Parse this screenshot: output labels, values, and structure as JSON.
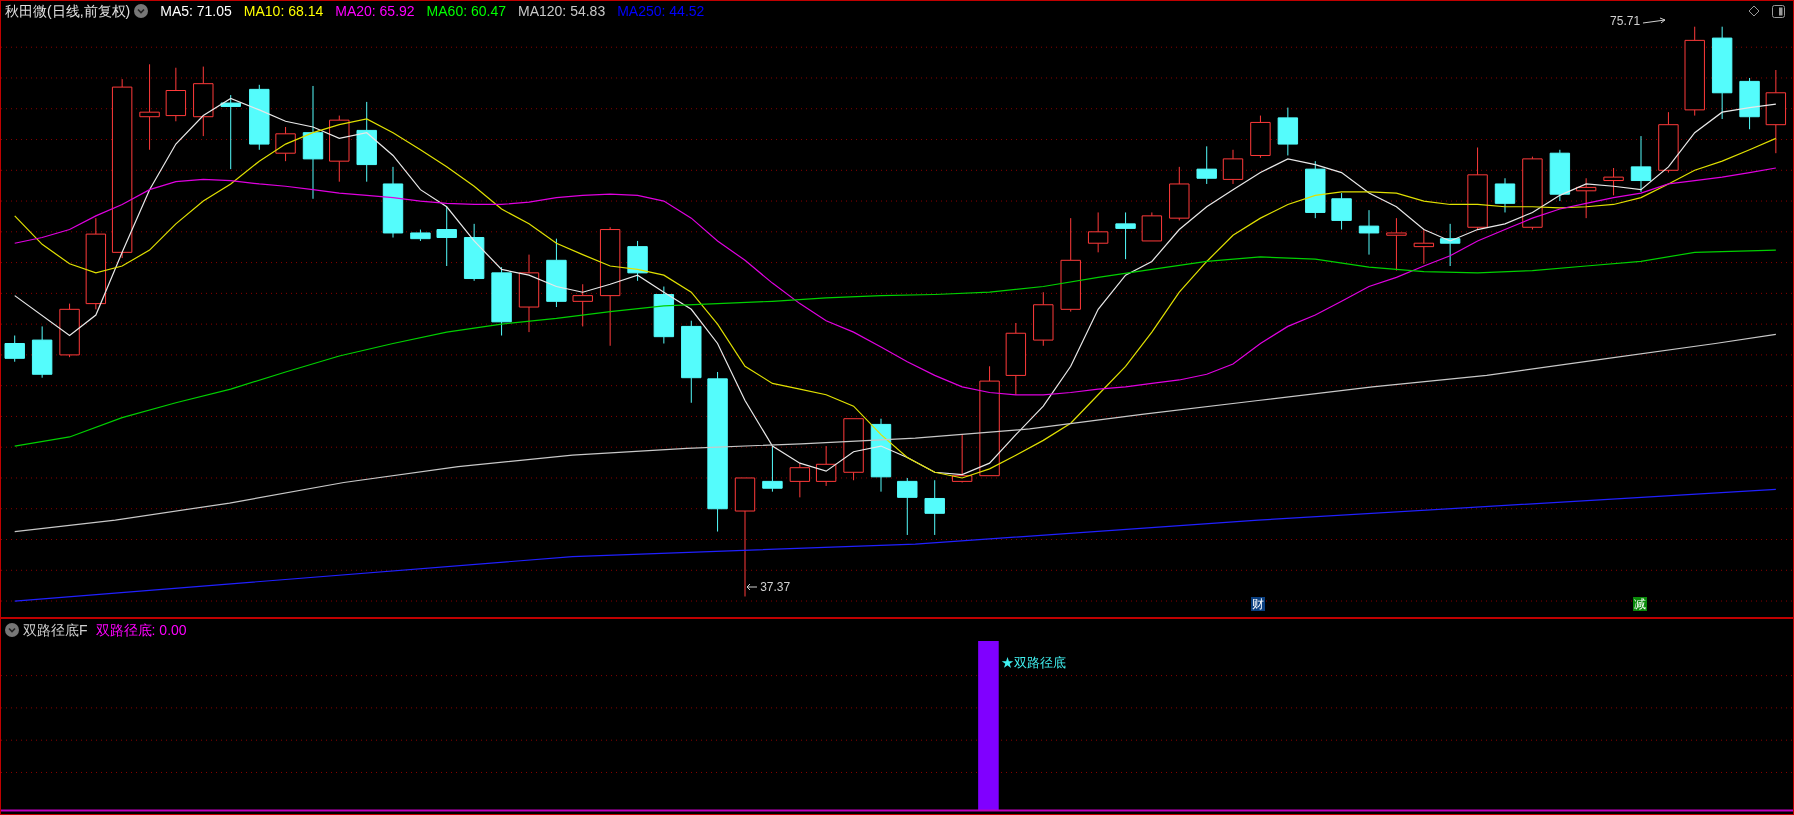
{
  "main_chart": {
    "title": "秋田微(日线,前复权)",
    "moving_averages": [
      {
        "text": "MA5: 71.05",
        "color": "#ffffff"
      },
      {
        "text": "MA10: 68.14",
        "color": "#ffff00"
      },
      {
        "text": "MA20: 65.92",
        "color": "#ff00ff"
      },
      {
        "text": "MA60: 60.47",
        "color": "#00ff00"
      },
      {
        "text": "MA120: 54.83",
        "color": "#c8c8c8"
      },
      {
        "text": "MA250: 44.52",
        "color": "#0000ff"
      }
    ],
    "price_labels": [
      {
        "kind": "high",
        "text": "75.71"
      },
      {
        "kind": "low",
        "text": "37.37"
      }
    ],
    "event_badges": [
      {
        "text": "财",
        "color": "#0a3f80"
      },
      {
        "text": "减",
        "color": "#0a8a0a"
      }
    ]
  },
  "indicator": {
    "title": "双路径底F",
    "reading": "双路径底: 0.00",
    "signal_label": "★双路径底"
  }
}
